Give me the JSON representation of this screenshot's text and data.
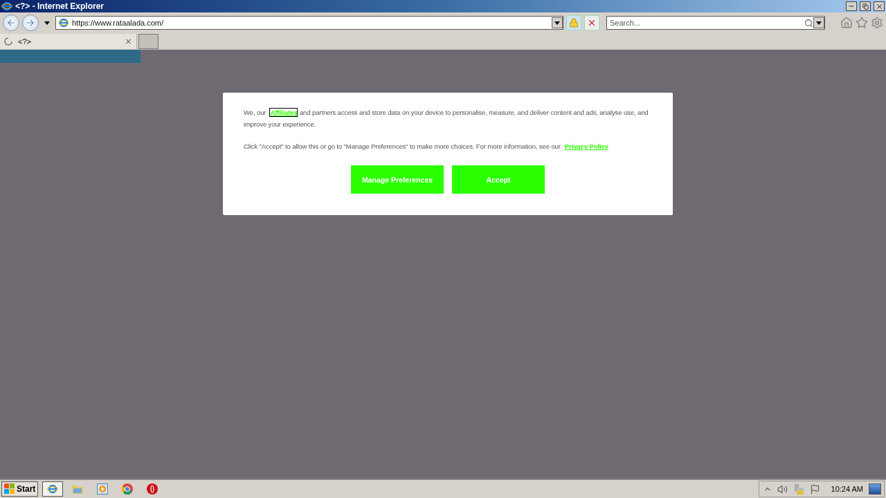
{
  "window": {
    "title": "<?> - Internet Explorer"
  },
  "address_bar": {
    "value": "https://www.rataalada.com/"
  },
  "search": {
    "placeholder": "Search..."
  },
  "tabs": [
    {
      "title": "<?>",
      "close": "×",
      "selected": true,
      "loading": true
    }
  ],
  "consent": {
    "paragraphs": [
      {
        "before": "We, our",
        "link": "Affiliates",
        "focused": true,
        "after": "and partners access and store data on your device to personalise, measure, and deliver content and ads, analyse use, and improve your experience."
      },
      {
        "before": "Click \"Accept\" to allow this or go to \"Manage Preferences\" to make more choices. For more information, see our",
        "link": "Privacy Policy",
        "focused": false
      }
    ],
    "buttons": [
      {
        "label": "Manage Preferences"
      },
      {
        "label": "Accept"
      }
    ]
  },
  "taskbar": {
    "start": "Start",
    "apps": [
      {
        "kind": "ie",
        "selected": true
      },
      {
        "kind": "folder",
        "selected": false
      },
      {
        "kind": "media",
        "selected": false
      },
      {
        "kind": "chrome",
        "selected": false
      },
      {
        "kind": "opera",
        "selected": false
      }
    ],
    "clock": "10:24 AM"
  }
}
